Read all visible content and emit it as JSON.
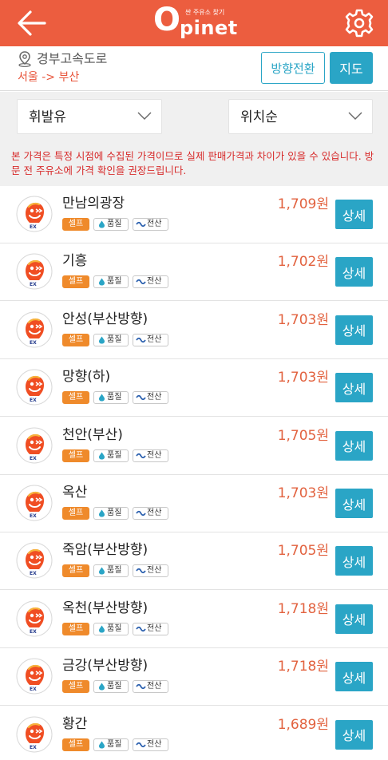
{
  "header": {
    "logo_tagline": "싼 주유소 찾기",
    "logo_o": "O",
    "logo_name": "pinet",
    "back_icon": "arrow-left-icon",
    "settings_icon": "gear-icon"
  },
  "route": {
    "road": "경부고속도로",
    "direction": "서울 -> 부산",
    "reverse_label": "방향전환",
    "map_label": "지도"
  },
  "filters": {
    "fuel": "휘발유",
    "sort": "위치순"
  },
  "notice": "본 가격은 특정 시점에 수집된 가격이므로 실제 판매가격과 차이가 있을 수 있습니다. 방문 전 주유소에 가격 확인을 권장드립니다.",
  "badges": {
    "self": "셀프",
    "quality": "품질",
    "computer": "전산"
  },
  "detail_label": "상세",
  "colors": {
    "brand": "#ec5d3f",
    "accent": "#2aa5c6",
    "price": "#e2623f",
    "notice": "#d72b2b",
    "self_badge": "#ef8a2b"
  },
  "stations": [
    {
      "name": "만남의광장",
      "price": "1,709원"
    },
    {
      "name": "기흥",
      "price": "1,702원"
    },
    {
      "name": "안성(부산방향)",
      "price": "1,703원"
    },
    {
      "name": "망향(하)",
      "price": "1,703원"
    },
    {
      "name": "천안(부산)",
      "price": "1,705원"
    },
    {
      "name": "옥산",
      "price": "1,703원"
    },
    {
      "name": "죽암(부산방향)",
      "price": "1,705원"
    },
    {
      "name": "옥천(부산방향)",
      "price": "1,718원"
    },
    {
      "name": "금강(부산방향)",
      "price": "1,718원"
    },
    {
      "name": "황간",
      "price": "1,689원"
    }
  ]
}
